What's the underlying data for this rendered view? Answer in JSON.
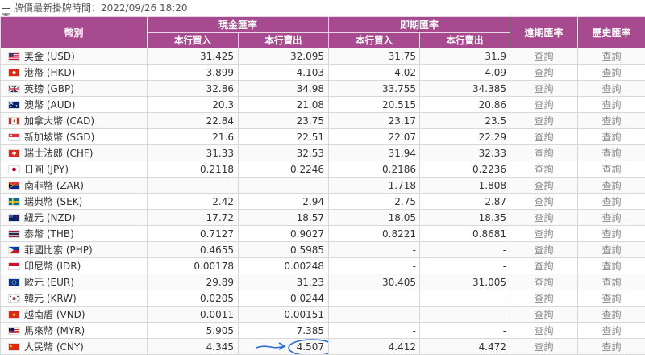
{
  "header": {
    "title": "牌價最新掛牌時間：2022/09/26 18:20"
  },
  "columns": {
    "currency": "幣別",
    "cash": "現金匯率",
    "spot": "即期匯率",
    "forward": "遠期匯率",
    "history": "歷史匯率",
    "buy": "本行買入",
    "sell": "本行賣出"
  },
  "query_label": "查詢",
  "rows": [
    {
      "name": "美金 (USD)",
      "flag": "us",
      "cash_buy": "31.425",
      "cash_sell": "32.095",
      "spot_buy": "31.75",
      "spot_sell": "31.9"
    },
    {
      "name": "港幣 (HKD)",
      "flag": "hk",
      "cash_buy": "3.899",
      "cash_sell": "4.103",
      "spot_buy": "4.02",
      "spot_sell": "4.09"
    },
    {
      "name": "英鎊 (GBP)",
      "flag": "gb",
      "cash_buy": "32.86",
      "cash_sell": "34.98",
      "spot_buy": "33.755",
      "spot_sell": "34.385"
    },
    {
      "name": "澳幣 (AUD)",
      "flag": "au",
      "cash_buy": "20.3",
      "cash_sell": "21.08",
      "spot_buy": "20.515",
      "spot_sell": "20.86"
    },
    {
      "name": "加拿大幣 (CAD)",
      "flag": "ca",
      "cash_buy": "22.84",
      "cash_sell": "23.75",
      "spot_buy": "23.17",
      "spot_sell": "23.5"
    },
    {
      "name": "新加坡幣 (SGD)",
      "flag": "sg",
      "cash_buy": "21.6",
      "cash_sell": "22.51",
      "spot_buy": "22.07",
      "spot_sell": "22.29"
    },
    {
      "name": "瑞士法郎 (CHF)",
      "flag": "ch",
      "cash_buy": "31.33",
      "cash_sell": "32.53",
      "spot_buy": "31.94",
      "spot_sell": "32.33"
    },
    {
      "name": "日圓 (JPY)",
      "flag": "jp",
      "cash_buy": "0.2118",
      "cash_sell": "0.2246",
      "spot_buy": "0.2186",
      "spot_sell": "0.2236"
    },
    {
      "name": "南非幣 (ZAR)",
      "flag": "za",
      "cash_buy": "-",
      "cash_sell": "-",
      "spot_buy": "1.718",
      "spot_sell": "1.808"
    },
    {
      "name": "瑞典幣 (SEK)",
      "flag": "se",
      "cash_buy": "2.42",
      "cash_sell": "2.94",
      "spot_buy": "2.75",
      "spot_sell": "2.87"
    },
    {
      "name": "紐元 (NZD)",
      "flag": "nz",
      "cash_buy": "17.72",
      "cash_sell": "18.57",
      "spot_buy": "18.05",
      "spot_sell": "18.35"
    },
    {
      "name": "泰幣 (THB)",
      "flag": "th",
      "cash_buy": "0.7127",
      "cash_sell": "0.9027",
      "spot_buy": "0.8221",
      "spot_sell": "0.8681"
    },
    {
      "name": "菲國比索 (PHP)",
      "flag": "ph",
      "cash_buy": "0.4655",
      "cash_sell": "0.5985",
      "spot_buy": "-",
      "spot_sell": "-"
    },
    {
      "name": "印尼幣 (IDR)",
      "flag": "id",
      "cash_buy": "0.00178",
      "cash_sell": "0.00248",
      "spot_buy": "-",
      "spot_sell": "-"
    },
    {
      "name": "歐元 (EUR)",
      "flag": "eu",
      "cash_buy": "29.89",
      "cash_sell": "31.23",
      "spot_buy": "30.405",
      "spot_sell": "31.005"
    },
    {
      "name": "韓元 (KRW)",
      "flag": "kr",
      "cash_buy": "0.0205",
      "cash_sell": "0.0244",
      "spot_buy": "-",
      "spot_sell": "-"
    },
    {
      "name": "越南盾 (VND)",
      "flag": "vn",
      "cash_buy": "0.0011",
      "cash_sell": "0.00151",
      "spot_buy": "-",
      "spot_sell": "-"
    },
    {
      "name": "馬來幣 (MYR)",
      "flag": "my",
      "cash_buy": "5.905",
      "cash_sell": "7.385",
      "spot_buy": "-",
      "spot_sell": "-"
    },
    {
      "name": "人民幣 (CNY)",
      "flag": "cn",
      "cash_buy": "4.345",
      "cash_sell": "4.507",
      "spot_buy": "4.412",
      "spot_sell": "4.472",
      "highlight": true
    }
  ],
  "colors": {
    "header_bg": "#a84a8f",
    "annotation": "#2a6fd6"
  }
}
